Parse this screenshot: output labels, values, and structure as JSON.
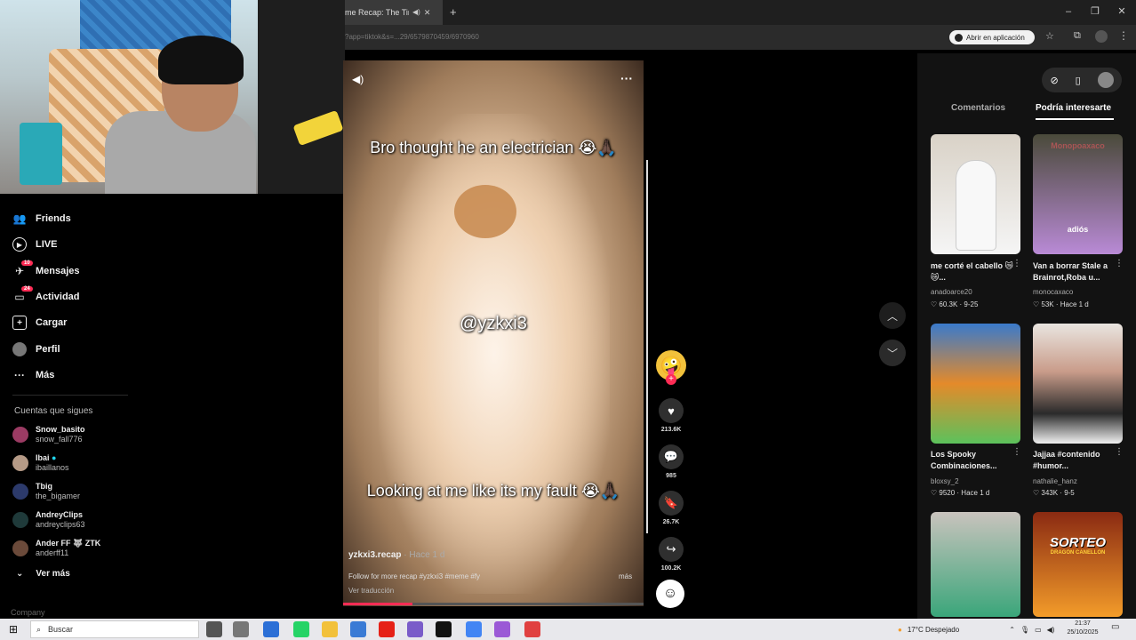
{
  "browser": {
    "tab_title": "me Recap: The Tim",
    "tab_audio_icon": "speaker-icon",
    "new_tab": "+",
    "url": "?app=tiktok&s=...29/6579870459/6970960",
    "open_in_app": "Abrir en aplicación",
    "window_min": "–",
    "window_max": "❐",
    "window_close": "✕"
  },
  "sidebar": {
    "items": [
      {
        "label": "Friends",
        "icon": "friends-icon"
      },
      {
        "label": "LIVE",
        "icon": "live-icon"
      },
      {
        "label": "Mensajes",
        "icon": "messages-icon",
        "badge": "10"
      },
      {
        "label": "Actividad",
        "icon": "activity-icon",
        "badge": "24"
      },
      {
        "label": "Cargar",
        "icon": "upload-icon"
      },
      {
        "label": "Perfil",
        "icon": "profile-icon"
      },
      {
        "label": "Más",
        "icon": "more-icon"
      }
    ],
    "following_title": "Cuentas que sigues",
    "accounts": [
      {
        "name": "Snow_basito",
        "handle": "snow_fall776"
      },
      {
        "name": "Ibai",
        "handle": "ibaillanos"
      },
      {
        "name": "Tbig",
        "handle": "the_bigamer"
      },
      {
        "name": "AndreyClips",
        "handle": "andreyclips63"
      },
      {
        "name": "Ander FF 🐺 ZTK",
        "handle": "anderff11"
      }
    ],
    "see_more": "Ver más",
    "company": "Company"
  },
  "video": {
    "caption_top": "Bro thought he an electrician 😭🙏🏿",
    "watermark": "@yzkxi3",
    "caption_bottom": "Looking at me like its my fault 😭🙏🏿",
    "author": "yzkxi3.recap",
    "time_ago": "Hace 1 d",
    "description": "Follow for more recap #yzkxi3 #meme #fy",
    "translate": "Ver traducción",
    "more": "más",
    "progress": 0.23,
    "likes": "213.6K",
    "comments": "985",
    "saves": "26.7K",
    "shares": "100.2K"
  },
  "right_panel": {
    "tab_comments": "Comentarios",
    "tab_interest": "Podría interesarte",
    "cards": [
      {
        "title": "me corté el cabello 😿😿...",
        "author": "anadoarce20",
        "stats": "♡ 60.3K · 9-25",
        "colors": [
          "#d9d2c7",
          "#f5f5f5"
        ]
      },
      {
        "title": "Van a borrar Stale a Brainrot,Roba u...",
        "author": "monocaxaco",
        "stats": "♡ 53K · Hace 1 d",
        "overlay": "adiós",
        "top_text": "Monopoaxaco",
        "colors": [
          "#4a4a3a",
          "#b98ad6"
        ]
      },
      {
        "title": "Los Spooky Combinaciones...",
        "author": "bloxsy_2",
        "stats": "♡ 9520 · Hace 1 d",
        "colors": [
          "#3a7acb",
          "#e48a2a"
        ]
      },
      {
        "title": "Jajjaa #contenido #humor...",
        "author": "nathalie_hanz",
        "stats": "♡ 343K · 9-5",
        "colors": [
          "#e9e5e0",
          "#2a2a2a"
        ]
      },
      {
        "title": "",
        "author": "",
        "stats": "",
        "colors": [
          "#c9c3bd",
          "#3aa67a"
        ]
      },
      {
        "title": "",
        "author": "",
        "stats": "",
        "overlay": "SORTEO",
        "subtitle": "DRAGON CANELLON",
        "colors": [
          "#8a2a12",
          "#f39c2a"
        ]
      }
    ]
  },
  "taskbar": {
    "search_placeholder": "Buscar",
    "weather": "17°C Despejado",
    "time": "21:37",
    "date": "25/10/2025"
  },
  "colors": {
    "accent": "#fe2c55",
    "background": "#000000",
    "panel": "#121212"
  }
}
